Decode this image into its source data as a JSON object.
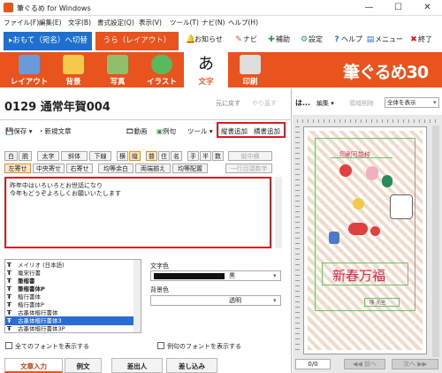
{
  "window": {
    "title": "筆ぐるめ for Windows",
    "minimize": "—",
    "maximize": "☐",
    "close": "✕"
  },
  "menu": [
    "ファイル(F)",
    "編集(E)",
    "文字(B)",
    "書式設定(Q)",
    "表示(V)",
    "ツール(T)",
    "ナビ(N)",
    "ヘルプ(H)"
  ],
  "mode": {
    "address_tab": "▸おもて（宛名）へ切替",
    "layout_tab": "うら（レイアウト）",
    "quick": [
      {
        "icon": "bell-icon",
        "glyph": "🔔",
        "label": "お知らせ"
      },
      {
        "icon": "navi-icon",
        "glyph": "✎",
        "label": "ナビ"
      },
      {
        "icon": "plus-icon",
        "glyph": "✚",
        "label": "補助"
      },
      {
        "icon": "gear-icon",
        "glyph": "⚙",
        "label": "設定"
      },
      {
        "icon": "help-icon",
        "glyph": "?",
        "label": "ヘルプ"
      },
      {
        "icon": "menu-icon",
        "glyph": "▤",
        "label": "メニュー"
      },
      {
        "icon": "exit-icon",
        "glyph": "✖",
        "label": "終了"
      }
    ]
  },
  "toolbar": {
    "tools": [
      "レイアウト",
      "背景",
      "写真",
      "イラスト",
      "文字",
      "印刷"
    ],
    "active": "文字",
    "brand": "筆ぐるめ30"
  },
  "editor": {
    "doc_title": "0129 通常年賀004",
    "undo": "元に戻す",
    "redo": "やり直す",
    "save": "保存",
    "new_text": "新規文章",
    "video": "動画",
    "example": "例句",
    "tools": "ツール",
    "add_vertical": "縦書追加",
    "add_horizontal": "横書追加",
    "row1": [
      "白",
      "脱",
      "太字",
      "斜体",
      "下線",
      "横",
      "縦",
      "普",
      "住",
      "名",
      "手",
      "半",
      "数",
      "縦中横"
    ],
    "row2": [
      "左寄せ",
      "中央寄せ",
      "右寄せ",
      "均等余白",
      "両端揃え",
      "均等配置",
      "一行目頭数字"
    ],
    "text_lines": [
      "昨年中はいろいろとお世話になり",
      "今年もどうぞよろしくお願いいたします"
    ],
    "fonts": [
      "メイリオ (日本語)",
      "毫宋行書",
      "筆楷書",
      "筆楷書体P",
      "楷行書体",
      "楷行書体P",
      "古墨体楷行書体",
      "古墨体楷行書体3",
      "古墨体楷行書体3P"
    ],
    "selected_font": "古墨体楷行書体3",
    "text_color_label": "文字色",
    "text_color_value": "黒",
    "bg_color_label": "背景色",
    "bg_color_value": "透明",
    "show_all_fonts": "全てのフォントを表示する",
    "show_example_fonts": "例句のフォントを表示する",
    "bottom_tabs": [
      "文章入力",
      "例文",
      "差出人",
      "差し込み"
    ]
  },
  "preview": {
    "toolbar_left": "は...",
    "edit": "編集",
    "delete": "領域削除",
    "view_select": "全体を表示",
    "printable_label": "印刷可能枠",
    "greeting": "新春万福",
    "sender": "序 元旦",
    "page_counter": "0/0",
    "prev": "前へ",
    "next": "次へ"
  },
  "colors": {
    "brand": "#e8531e",
    "nav_blue": "#1f6fd0",
    "highlight": "#e01a1a",
    "greeting": "#d8284a"
  }
}
